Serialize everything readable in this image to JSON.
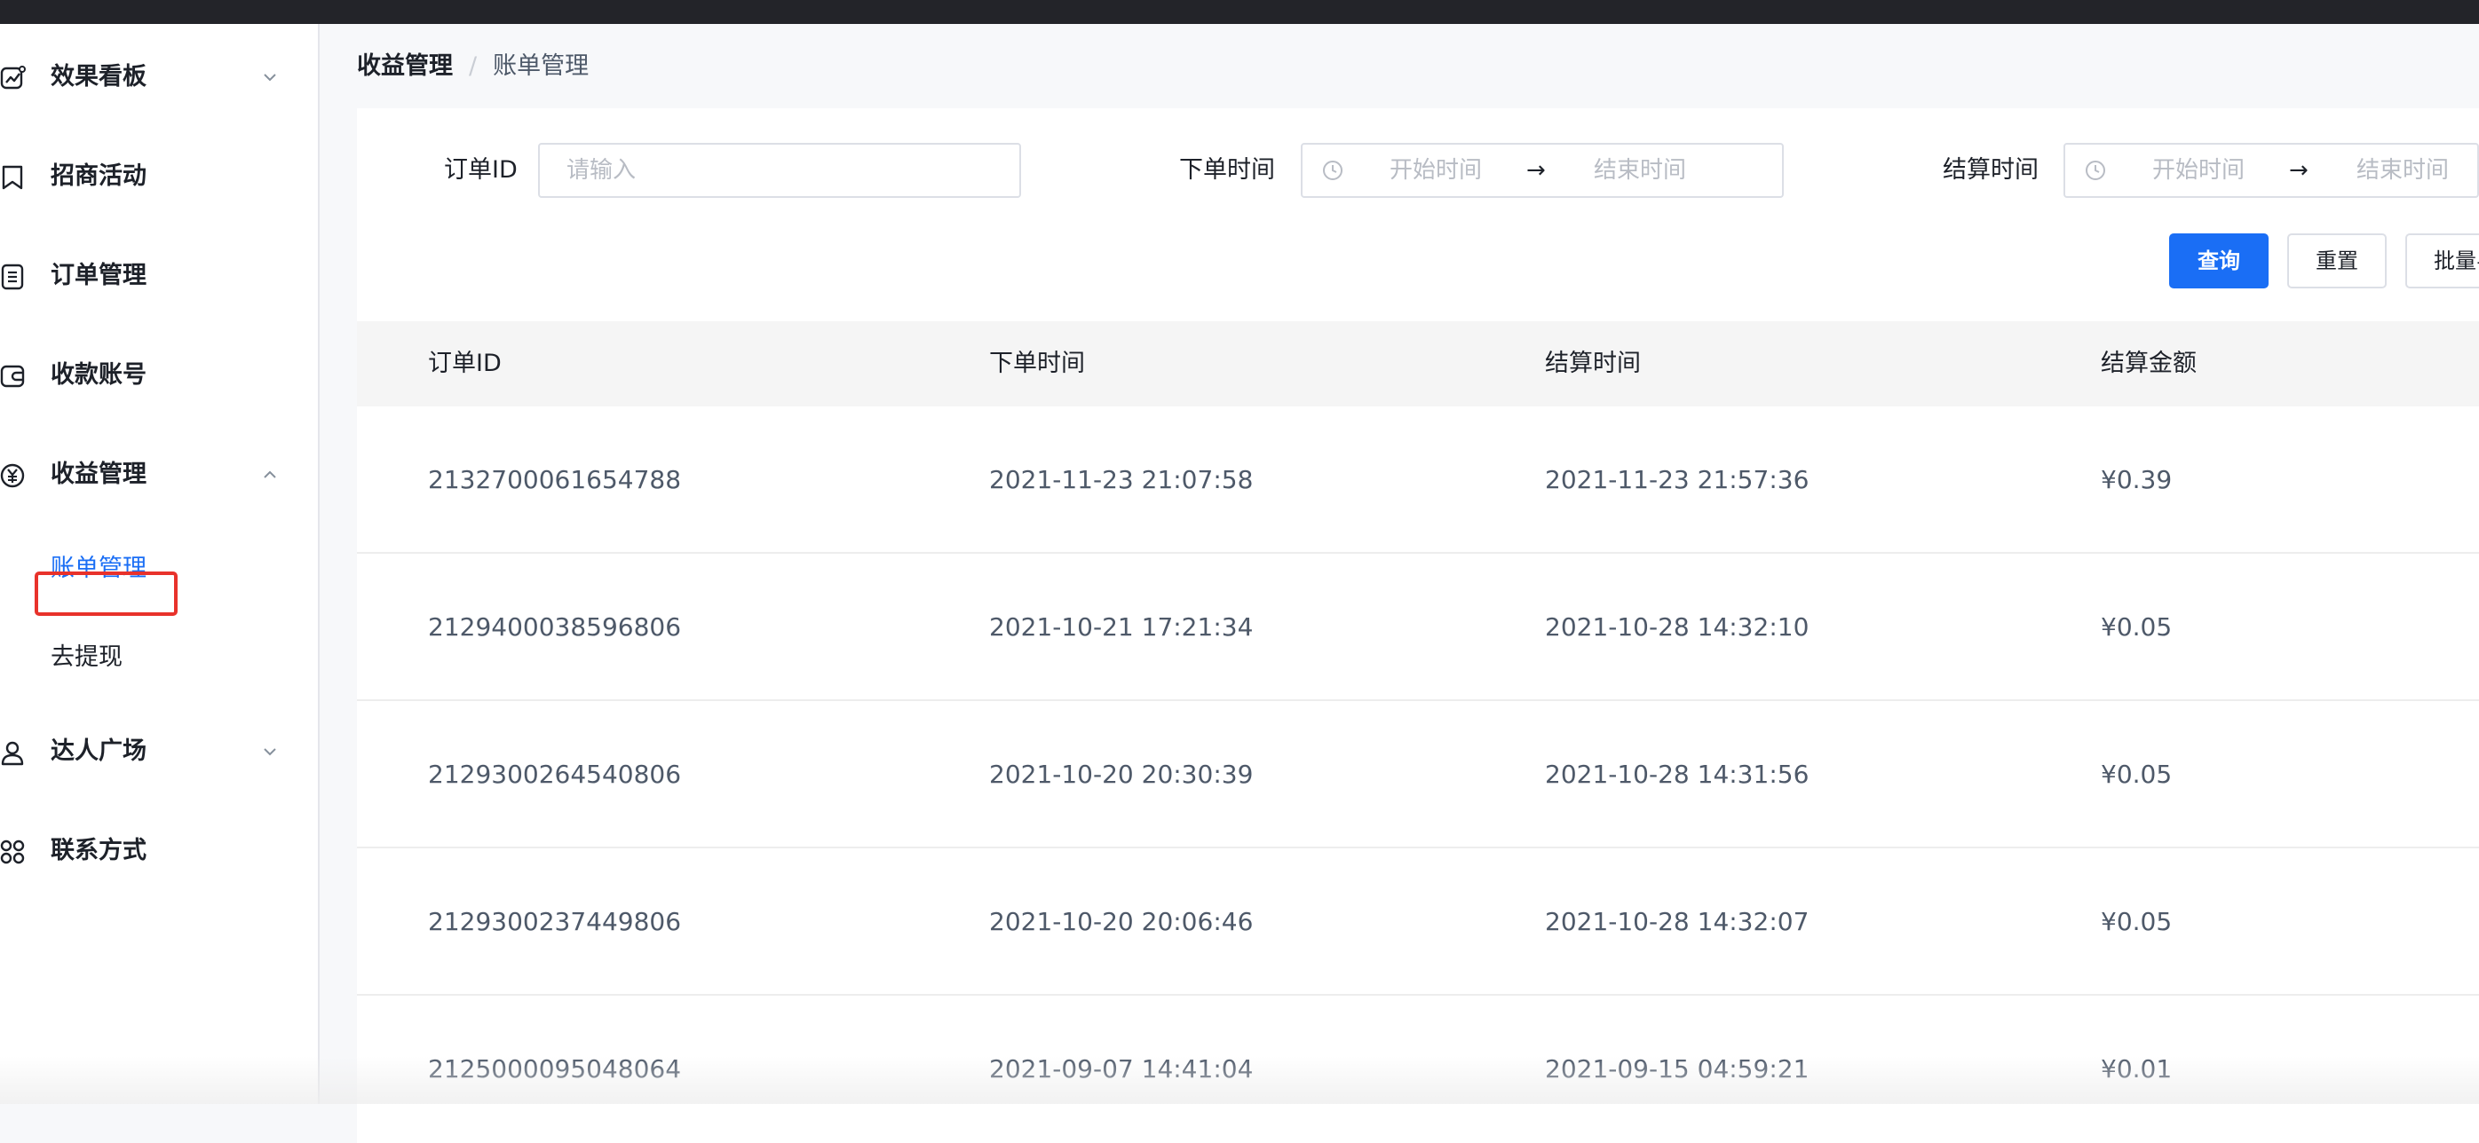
{
  "sidebar": {
    "items": [
      {
        "label": "效果看板",
        "icon": "chart-line-icon",
        "expanded": false
      },
      {
        "label": "招商活动",
        "icon": "bookmark-icon"
      },
      {
        "label": "订单管理",
        "icon": "document-list-icon"
      },
      {
        "label": "收款账号",
        "icon": "wallet-icon"
      },
      {
        "label": "收益管理",
        "icon": "yen-circle-icon",
        "expanded": true,
        "children": [
          {
            "label": "账单管理",
            "active": true
          },
          {
            "label": "去提现",
            "active": false
          }
        ]
      },
      {
        "label": "达人广场",
        "icon": "user-icon",
        "expanded": false
      },
      {
        "label": "联系方式",
        "icon": "grid-apps-icon"
      }
    ]
  },
  "breadcrumb": {
    "parent": "收益管理",
    "separator": "/",
    "current": "账单管理"
  },
  "filters": {
    "order_id": {
      "label": "订单ID",
      "placeholder": "请输入"
    },
    "order_time": {
      "label": "下单时间",
      "start_placeholder": "开始时间",
      "end_placeholder": "结束时间",
      "arrow": "→"
    },
    "settle_time": {
      "label": "结算时间",
      "start_placeholder": "开始时间",
      "end_placeholder": "结束时间",
      "arrow": "→"
    }
  },
  "buttons": {
    "query": "查询",
    "reset": "重置",
    "batch": "批量导"
  },
  "table": {
    "columns": [
      "订单ID",
      "下单时间",
      "结算时间",
      "结算金额"
    ],
    "rows": [
      [
        "2132700061654788",
        "2021-11-23 21:07:58",
        "2021-11-23 21:57:36",
        "¥0.39"
      ],
      [
        "2129400038596806",
        "2021-10-21 17:21:34",
        "2021-10-28 14:32:10",
        "¥0.05"
      ],
      [
        "2129300264540806",
        "2021-10-20 20:30:39",
        "2021-10-28 14:31:56",
        "¥0.05"
      ],
      [
        "2129300237449806",
        "2021-10-20 20:06:46",
        "2021-10-28 14:32:07",
        "¥0.05"
      ],
      [
        "2125000095048064",
        "2021-09-07 14:41:04",
        "2021-09-15 04:59:21",
        "¥0.01"
      ]
    ]
  },
  "colors": {
    "primary": "#1a6ef5",
    "highlight": "#e8322b",
    "topbar": "#232429"
  }
}
